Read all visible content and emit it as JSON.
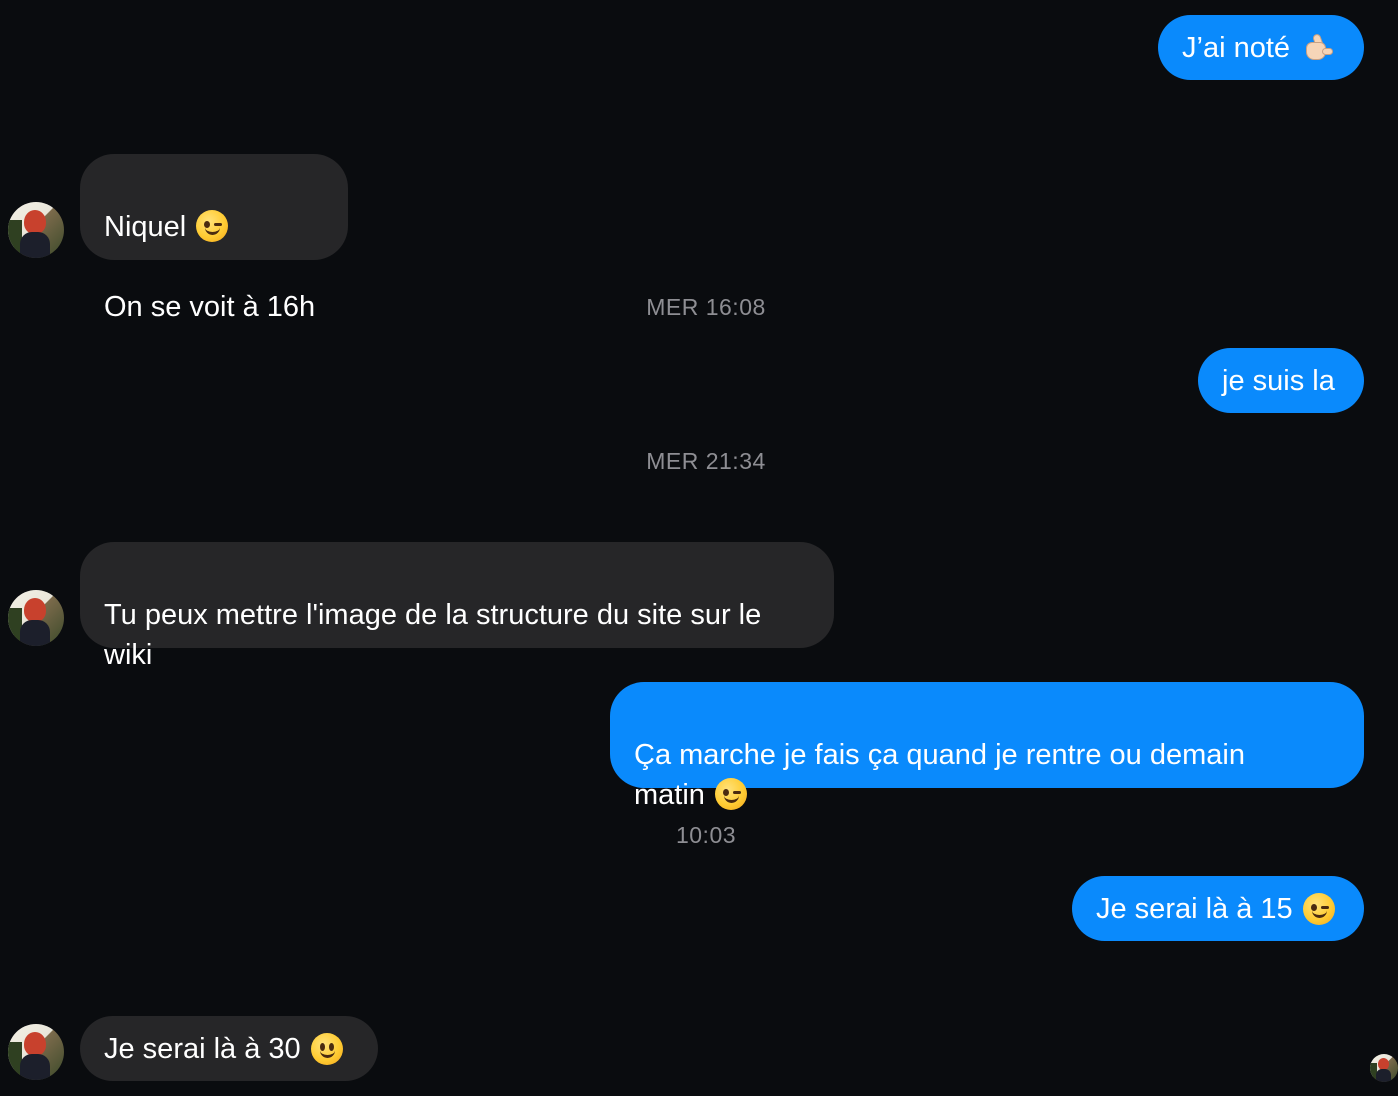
{
  "messages": [
    {
      "id": "m1",
      "direction": "outgoing",
      "text": "J’ai noté",
      "emoji": "call-me-hand"
    },
    {
      "id": "m2",
      "direction": "incoming",
      "text": "Niquel",
      "emoji": "winking-face",
      "line2": "On se voit à 16h"
    },
    {
      "id": "m3",
      "direction": "outgoing",
      "text": "je suis la"
    },
    {
      "id": "m4",
      "direction": "incoming",
      "text": "Tu peux mettre l'image de la structure du site sur le\nwiki"
    },
    {
      "id": "m5",
      "direction": "outgoing",
      "text": "Ça marche je fais ça quand je rentre ou demain\nmatin",
      "emoji": "winking-face"
    },
    {
      "id": "m6",
      "direction": "outgoing",
      "text": "Je serai là à 15",
      "emoji": "winking-face"
    },
    {
      "id": "m7",
      "direction": "incoming",
      "text": "Je serai là à 30",
      "emoji": "slightly-smiling-face"
    }
  ],
  "timestamps": [
    "MER 16:08",
    "MER 21:34",
    "10:03"
  ],
  "colors": {
    "background": "#0a0c0f",
    "outgoing_bubble": "#0a8afc",
    "incoming_bubble": "#262628",
    "timestamp_text": "#8e8e93"
  }
}
